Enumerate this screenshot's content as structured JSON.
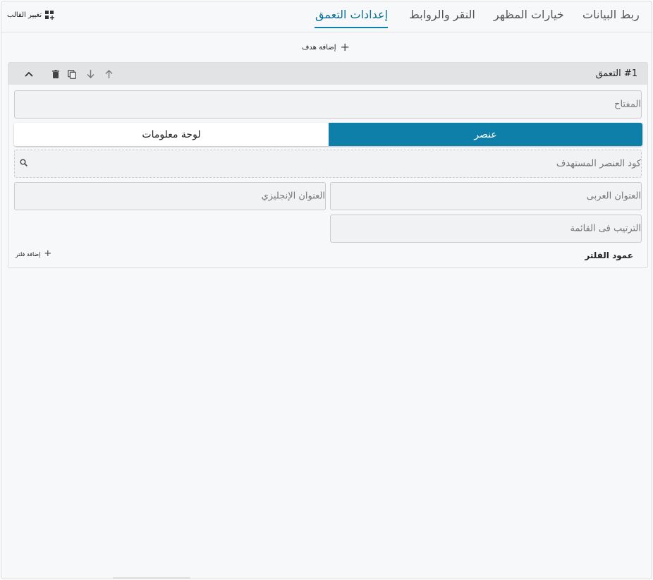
{
  "tabs": [
    {
      "label": "ربط البيانات",
      "active": false
    },
    {
      "label": "خيارات المظهر",
      "active": false
    },
    {
      "label": "النقر والروابط",
      "active": false
    },
    {
      "label": "إعدادات التعمق",
      "active": true
    }
  ],
  "toolbar": {
    "change_template": "تغيير القالب",
    "change_template_icon": "dashboard-add-icon"
  },
  "add_target": {
    "label": "إضافة هدف",
    "icon": "plus-icon"
  },
  "drill_panel": {
    "title": "#1  التعمق",
    "actions": [
      "collapse-icon",
      "delete-icon",
      "copy-icon",
      "move-down-icon",
      "move-up-icon"
    ],
    "key_field": {
      "placeholder": "المفتاح",
      "value": ""
    },
    "target_type": {
      "options": [
        "عنصر",
        "لوحة معلومات"
      ],
      "selected": "عنصر"
    },
    "target_code": {
      "placeholder": "كود العنصر المستهدف",
      "value": ""
    },
    "title_ar": {
      "placeholder": "العنوان العربى",
      "value": ""
    },
    "title_en": {
      "placeholder": "العنوان الإنجليزي",
      "value": ""
    },
    "order": {
      "placeholder": "الترتيب فى القائمة",
      "value": ""
    },
    "filter_column": {
      "label": "عمود الفلتر"
    },
    "add_filter": {
      "label": "إضافة فلتر"
    }
  },
  "colors": {
    "accent": "#0e7fa8",
    "active_tab": "#0e6f95"
  }
}
